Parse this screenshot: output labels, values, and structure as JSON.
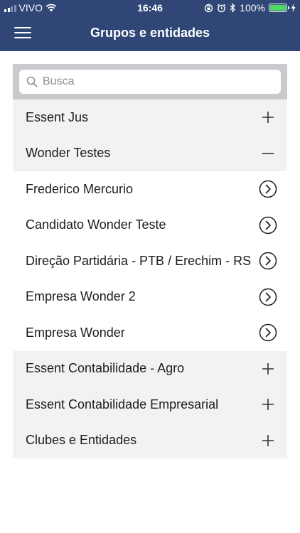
{
  "status_bar": {
    "carrier": "VIVO",
    "time": "16:46",
    "battery_pct": "100%"
  },
  "nav": {
    "title": "Grupos e entidades"
  },
  "search": {
    "placeholder": "Busca",
    "value": ""
  },
  "rows": [
    {
      "label": "Essent Jus",
      "kind": "group",
      "icon": "plus-icon"
    },
    {
      "label": "Wonder Testes",
      "kind": "group",
      "icon": "minus-icon"
    },
    {
      "label": "Frederico Mercurio",
      "kind": "child",
      "icon": "chevron-right-circle-icon"
    },
    {
      "label": "Candidato Wonder Teste",
      "kind": "child",
      "icon": "chevron-right-circle-icon"
    },
    {
      "label": "Direção Partidária - PTB / Erechim - RS",
      "kind": "child",
      "icon": "chevron-right-circle-icon"
    },
    {
      "label": "Empresa Wonder 2",
      "kind": "child",
      "icon": "chevron-right-circle-icon"
    },
    {
      "label": "Empresa Wonder",
      "kind": "child",
      "icon": "chevron-right-circle-icon"
    },
    {
      "label": "Essent Contabilidade - Agro",
      "kind": "group",
      "icon": "plus-icon"
    },
    {
      "label": "Essent Contabilidade Empresarial",
      "kind": "group",
      "icon": "plus-icon"
    },
    {
      "label": "Clubes e Entidades",
      "kind": "group",
      "icon": "plus-icon"
    }
  ],
  "colors": {
    "nav_background": "#2f4677",
    "group_row_background": "#f2f2f2",
    "battery_fill": "#4cd964"
  }
}
